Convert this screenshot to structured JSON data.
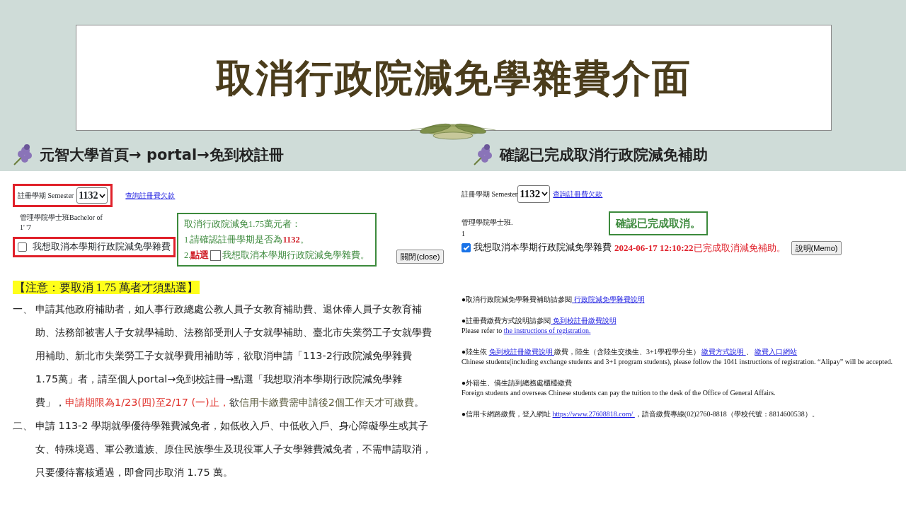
{
  "slide": {
    "title": "取消行政院減免學雜費介面"
  },
  "left": {
    "heading": "元智大學首頁→ portal→免到校註冊",
    "semester_label": "註冊學期 Semester",
    "semester_value": "1132",
    "fee_link": "查詢註冊費欠款",
    "program": "管理學院學士班Bachelor of",
    "student_id": "1'      '7",
    "checkbox": {
      "label": "我想取消本學期行政院減免學雜費",
      "checked": false
    },
    "callout": [
      {
        "kind": "text",
        "before": "取消行政院減免1.75萬元者："
      },
      {
        "kind": "text",
        "before": "1.請確認註冊學期是否為 ",
        "highlight": "1132",
        "after": "。"
      },
      {
        "kind": "click",
        "before": "2.",
        "highlight": "點選",
        "after": "我想取消本學期行政院減免學雜費。"
      }
    ],
    "close_button": "關閉(close)",
    "notice": "【注意：要取消 1.75 萬者才須點選】",
    "items": [
      {
        "marker": "一、",
        "parts": [
          {
            "kind": "normal",
            "text": "申請其他政府補助者，如人事行政總處公教人員子女教育補助費、退休俸人員子女教育補助、法務部被害人子女就學補助、法務部受刑人子女就學補助、臺北市失業勞工子女就學費用補助、新北市失業勞工子女就學費用補助等，欲取消申請「113-2行政院減免學雜費1.75萬」者，請至個人portal→免到校註冊→點選「我想取消本學期行政院減免學雜費」，"
          },
          {
            "kind": "deadline",
            "text": "申請期限為1/23(四)至2/17 (一)止，"
          },
          {
            "kind": "normal",
            "text": "欲"
          },
          {
            "kind": "muted",
            "text": "信用卡繳費需申請後2個工作天才可繳費"
          },
          {
            "kind": "normal",
            "text": "。"
          }
        ]
      },
      {
        "marker": "二、",
        "parts": [
          {
            "kind": "normal",
            "text": "申請 113-2 學期就學優待學雜費減免者，如低收入戶、中低收入戶、身心障礙學生或其子女、特殊境遇、軍公教遺族、原住民族學生及現役軍人子女學雜費減免者，不需申請取消，只要優待審核通過，即會同步取消 1.75 萬。"
          }
        ]
      }
    ]
  },
  "right": {
    "heading": "確認已完成取消行政院減免補助",
    "semester_label": "註冊學期 Semester",
    "semester_value": "1132",
    "fee_link": "查詢註冊費欠款",
    "program": "管理學院學士班.",
    "student_id": "1",
    "confirm_callout": "確認已完成取消。",
    "checkbox": {
      "label": "我想取消本學期行政院減免學雜費",
      "checked": true
    },
    "status_time": "2024-06-17 12:10:22",
    "status_text": "已完成取消減免補助。",
    "memo_button": "說明(Memo)",
    "notes": [
      [
        [
          {
            "text": "●取消行政院減免學雜費補助請參閱"
          },
          {
            "text": " 行政院減免學雜費說明 ",
            "link": true
          }
        ]
      ],
      [
        [
          {
            "text": "●註冊費繳費方式說明請參閱"
          },
          {
            "text": " 免到校註冊繳費說明 ",
            "link": true
          }
        ],
        [
          {
            "text": "Please refer to "
          },
          {
            "text": "the instructions of registration.",
            "link": true
          }
        ]
      ],
      [
        [
          {
            "text": "●陸生依 "
          },
          {
            "text": " 免到校註冊繳費說明 ",
            "link": true
          },
          {
            "text": " 繳費，陸生（含陸生交換生、3+1學程學分生） "
          },
          {
            "text": " 繳費方式說明 ",
            "link": true
          },
          {
            "text": " 、 "
          },
          {
            "text": " 繳費入口網站 ",
            "link": true
          }
        ],
        [
          {
            "text": "Chinese students(including exchange students and 3+1 program students), please follow the 1041 instructions of registration. “Alipay” will be accepted."
          }
        ]
      ],
      [
        [
          {
            "text": "●外籍生、僑生請到總務處櫃檯繳費"
          }
        ],
        [
          {
            "text": "Foreign students and overseas Chinese students can pay the tuition to the desk of the Office of General Affairs."
          }
        ]
      ],
      [
        [
          {
            "text": "●信用卡網路繳費，登入網址 "
          },
          {
            "text": " https://www.27608818.com/ ",
            "link": true
          },
          {
            "text": "，語音繳費專線(02)2760-8818（學校代號：8814600538）。"
          }
        ]
      ]
    ]
  }
}
